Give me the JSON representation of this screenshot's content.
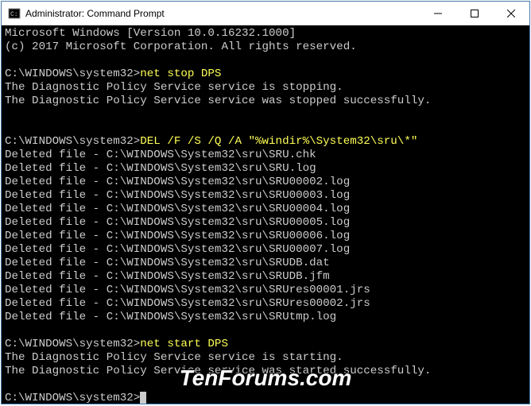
{
  "window": {
    "title": "Administrator: Command Prompt"
  },
  "terminal": {
    "header1": "Microsoft Windows [Version 10.0.16232.1000]",
    "header2": "(c) 2017 Microsoft Corporation. All rights reserved.",
    "prompt1": "C:\\WINDOWS\\system32>",
    "cmd1": "net stop DPS",
    "out1a": "The Diagnostic Policy Service service is stopping.",
    "out1b": "The Diagnostic Policy Service service was stopped successfully.",
    "prompt2": "C:\\WINDOWS\\system32>",
    "cmd2": "DEL /F /S /Q /A \"%windir%\\System32\\sru\\*\"",
    "del01": "Deleted file - C:\\WINDOWS\\System32\\sru\\SRU.chk",
    "del02": "Deleted file - C:\\WINDOWS\\System32\\sru\\SRU.log",
    "del03": "Deleted file - C:\\WINDOWS\\System32\\sru\\SRU00002.log",
    "del04": "Deleted file - C:\\WINDOWS\\System32\\sru\\SRU00003.log",
    "del05": "Deleted file - C:\\WINDOWS\\System32\\sru\\SRU00004.log",
    "del06": "Deleted file - C:\\WINDOWS\\System32\\sru\\SRU00005.log",
    "del07": "Deleted file - C:\\WINDOWS\\System32\\sru\\SRU00006.log",
    "del08": "Deleted file - C:\\WINDOWS\\System32\\sru\\SRU00007.log",
    "del09": "Deleted file - C:\\WINDOWS\\System32\\sru\\SRUDB.dat",
    "del10": "Deleted file - C:\\WINDOWS\\System32\\sru\\SRUDB.jfm",
    "del11": "Deleted file - C:\\WINDOWS\\System32\\sru\\SRUres00001.jrs",
    "del12": "Deleted file - C:\\WINDOWS\\System32\\sru\\SRUres00002.jrs",
    "del13": "Deleted file - C:\\WINDOWS\\System32\\sru\\SRUtmp.log",
    "prompt3": "C:\\WINDOWS\\system32>",
    "cmd3": "net start DPS",
    "out3a": "The Diagnostic Policy Service service is starting.",
    "out3b": "The Diagnostic Policy Service service was started successfully.",
    "prompt4": "C:\\WINDOWS\\system32>"
  },
  "watermark": "TenForums.com"
}
